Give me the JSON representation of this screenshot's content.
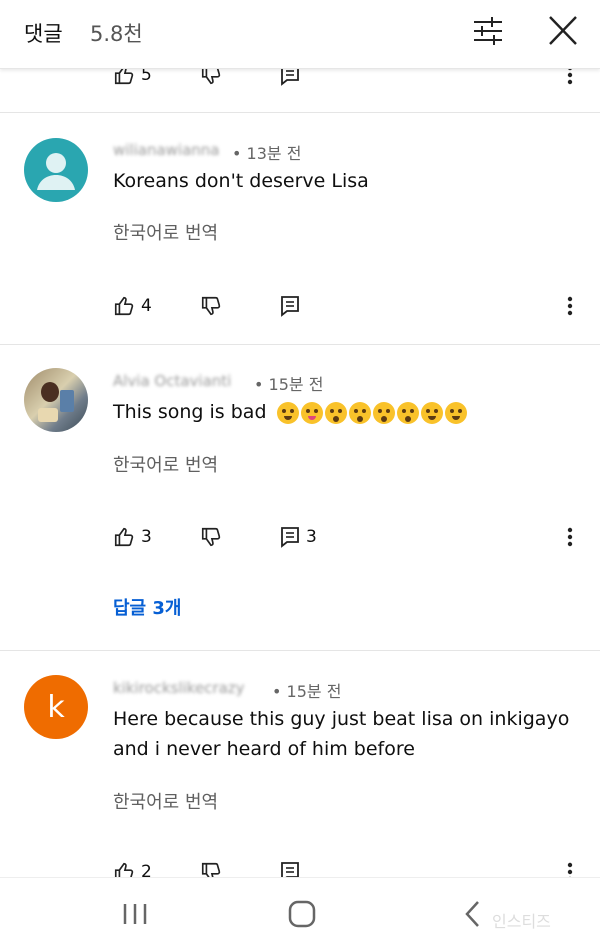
{
  "header": {
    "title": "댓글",
    "count": "5.8천",
    "filter_icon": "sliders-icon",
    "close_icon": "close-icon"
  },
  "top_actions": {
    "likes": "5"
  },
  "comments": [
    {
      "username": "wilianawianna",
      "time": "• 13분 전",
      "text": "Koreans don't deserve Lisa",
      "translate": "한국어로 번역",
      "likes": "4",
      "avatar_color": "#2aa6b0"
    },
    {
      "username": "Alvia Octavianti",
      "time": "• 15분 전",
      "text": "This song is bad",
      "emojis": 8,
      "translate": "한국어로 번역",
      "likes": "3",
      "reply_count": "3",
      "replies_link": "답글 3개"
    },
    {
      "username": "kikirockslikecrazy",
      "time": "• 15분 전",
      "avatar_letter": "k",
      "avatar_color": "#ef6c00",
      "text_lines": [
        "Here because this guy just beat lisa on inkigayo",
        "and i never heard of him before"
      ],
      "translate": "한국어로 번역",
      "likes": "2"
    }
  ],
  "navbar": {
    "recent_icon": "recent-apps-icon",
    "home_icon": "home-icon",
    "back_icon": "back-icon",
    "watermark": "인스티즈"
  }
}
